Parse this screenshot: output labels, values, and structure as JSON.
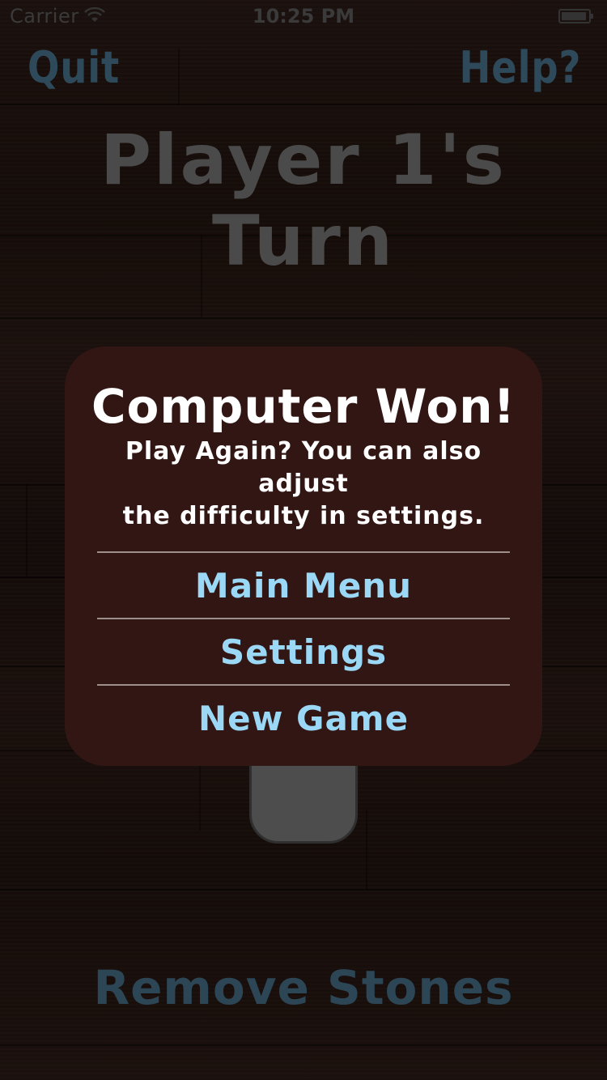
{
  "status_bar": {
    "carrier": "Carrier",
    "time": "10:25 PM"
  },
  "header": {
    "quit_label": "Quit",
    "help_label": "Help?",
    "turn_title": "Player 1's Turn"
  },
  "footer": {
    "remove_stones_label": "Remove Stones"
  },
  "alert": {
    "title": "Computer Won!",
    "message_line1": "Play Again? You can also adjust",
    "message_line2": "the difficulty in settings.",
    "buttons": [
      {
        "label": "Main Menu"
      },
      {
        "label": "Settings"
      },
      {
        "label": "New Game"
      }
    ]
  },
  "colors": {
    "alert_background": "#321614",
    "button_text": "#9ad8f5",
    "dimmed_link": "#2e4a5a"
  },
  "icons": [
    "wifi-icon",
    "battery-icon"
  ]
}
